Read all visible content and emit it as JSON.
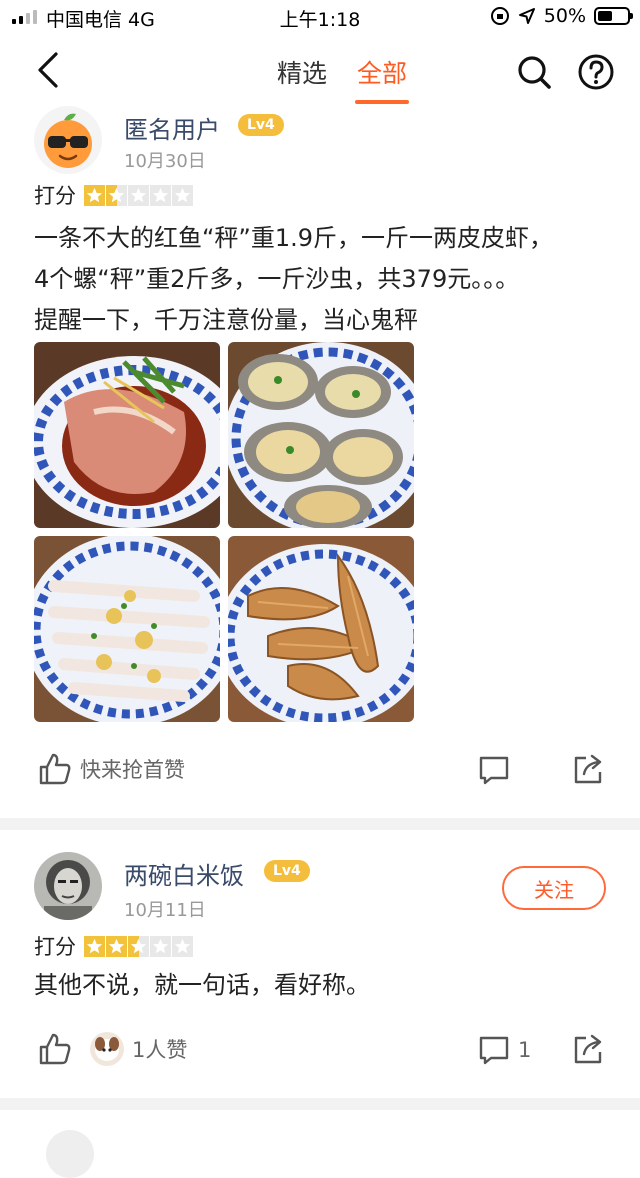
{
  "status_bar": {
    "carrier": "中国电信 4G",
    "time": "上午1:18",
    "battery": "50%",
    "battery_level": 0.5
  },
  "nav": {
    "tabs": [
      {
        "label": "精选",
        "active": false
      },
      {
        "label": "全部",
        "active": true
      }
    ]
  },
  "reviews": [
    {
      "user": "匿名用户",
      "level": "Lv4",
      "date": "10月30日",
      "score_label": "打分",
      "rating": 1.5,
      "text_lines": [
        "一条不大的红鱼“秤”重1.9斤，一斤一两皮皮虾，",
        "4个螺“秤”重2斤多，一斤沙虫，共379元。。。",
        "提醒一下，千万注意份量，当心鬼秤"
      ],
      "photos": [
        "steamed-fish",
        "steamed-shellfish",
        "garlic-sandworm",
        "fried-mantis-shrimp"
      ],
      "like_text": "快来抢首赞"
    },
    {
      "user": "两碗白米饭",
      "level": "Lv4",
      "date": "10月11日",
      "score_label": "打分",
      "rating": 2.5,
      "follow_label": "关注",
      "text_lines": [
        "其他不说，就一句话，看好称。"
      ],
      "like_text": "1人赞",
      "comment_count": "1"
    }
  ],
  "colors": {
    "accent": "#ff5a1f",
    "username": "#3a4a6b",
    "level_badge": "#f4be3c",
    "star": "#f2c23b"
  }
}
